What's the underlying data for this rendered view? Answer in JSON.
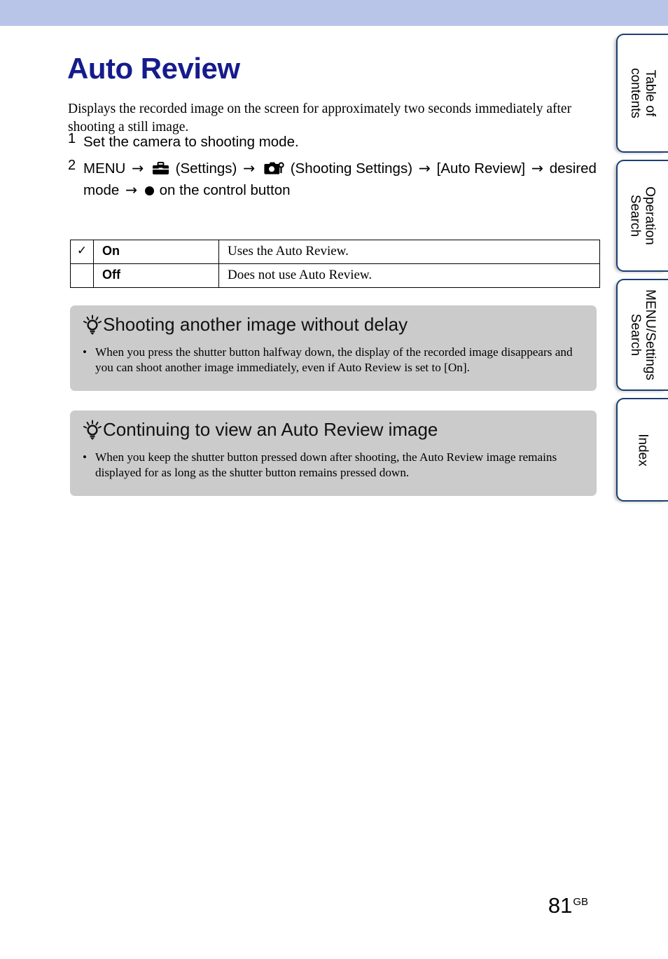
{
  "colors": {
    "header_band": "#b9c5e8",
    "title": "#161b8c",
    "tip_box": "#cbcbcb",
    "tab_border": "#1b3f72"
  },
  "header": {
    "title": "Auto Review"
  },
  "intro": {
    "text": "Displays the recorded image on the screen for approximately two seconds immediately after shooting a still image."
  },
  "steps": [
    {
      "number": "1",
      "text": "Set the camera to shooting mode."
    },
    {
      "number": "2",
      "prefix": "MENU",
      "settings_label": "(Settings)",
      "shooting_label": "(Shooting Settings)",
      "menu_item": "[Auto Review]",
      "tail_before_dot": "desired mode",
      "tail_after_dot": "on the control button",
      "arrow": "→"
    }
  ],
  "options_table": {
    "rows": [
      {
        "checked": "✓",
        "name": "On",
        "description": "Uses the Auto Review."
      },
      {
        "checked": "",
        "name": "Off",
        "description": "Does not use Auto Review."
      }
    ]
  },
  "tips": [
    {
      "heading": "Shooting another image without delay",
      "bullet": "•",
      "body": "When you press the shutter button halfway down, the display of the recorded image disappears and you can shoot another image immediately, even if Auto Review is set to [On]."
    },
    {
      "heading": "Continuing to view an Auto Review image",
      "bullet": "•",
      "body": "When you keep the shutter button pressed down after shooting, the Auto Review image remains displayed for as long as the shutter button remains pressed down."
    }
  ],
  "side_tabs": [
    {
      "label": "Table of\ncontents"
    },
    {
      "label": "Operation\nSearch"
    },
    {
      "label": "MENU/Settings\nSearch"
    },
    {
      "label": "Index"
    }
  ],
  "footer": {
    "page_number": "81",
    "region_code": "GB"
  }
}
